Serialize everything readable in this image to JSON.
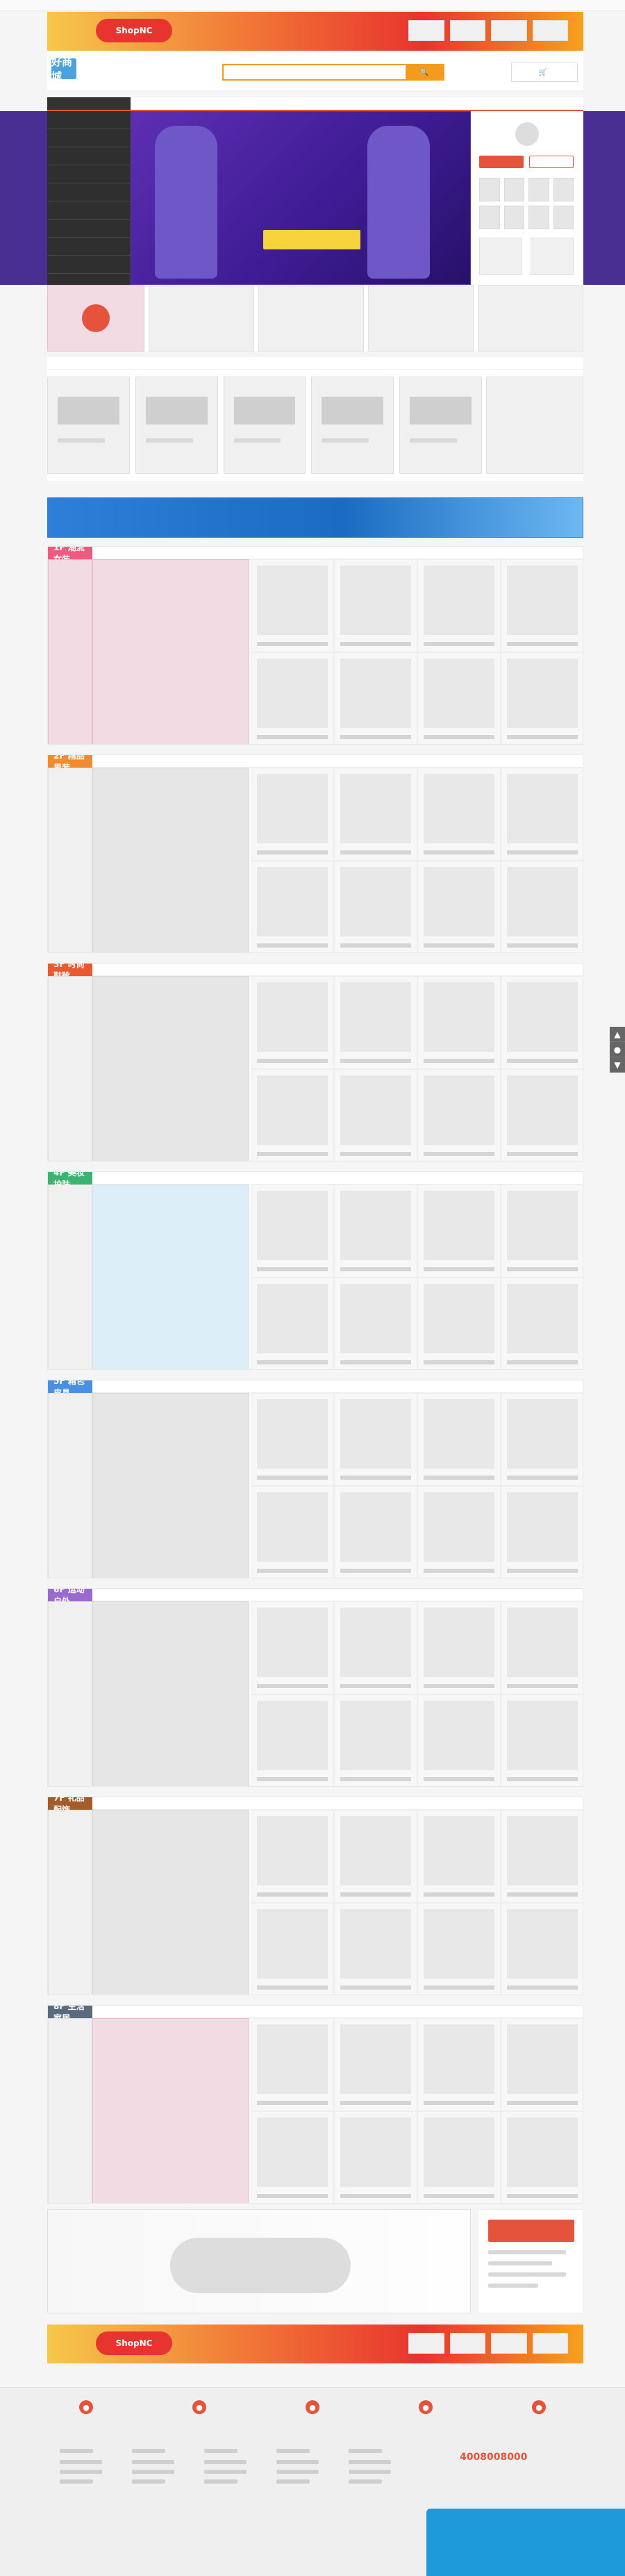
{
  "colors": {
    "accent": "#e5533d",
    "brand_green": "#2aa95b",
    "brand_blue": "#4aa3df",
    "top_banner_red": "#e8342e",
    "nav_red": "#e5533d",
    "floor_1": "#f05a7e",
    "floor_2": "#f28b2f",
    "floor_3": "#e95a31",
    "floor_4": "#3cb371",
    "floor_5": "#4a90e2",
    "floor_6": "#9a6ad1",
    "floor_7": "#a25d2a",
    "floor_8": "#5b6b7f"
  },
  "top_links": [
    "",
    "",
    "",
    "",
    "",
    "",
    ""
  ],
  "top_banner": {
    "left_logo": "ShopNC",
    "message": "",
    "tags": [
      "",
      "",
      "",
      ""
    ]
  },
  "header": {
    "logo": "好商城",
    "search_placeholder": "",
    "cart_label": ""
  },
  "nav": {
    "items": [
      "",
      "",
      "",
      "",
      "",
      "",
      "",
      "",
      "",
      ""
    ]
  },
  "sidebar": {
    "title": "",
    "items": [
      "",
      "",
      "",
      "",
      "",
      "",
      "",
      "",
      "",
      "",
      "",
      "",
      "",
      ""
    ]
  },
  "hero": {
    "headline": "",
    "subline": "",
    "cta": ""
  },
  "right_panel": {
    "login_button": "",
    "register_button": ""
  },
  "small_panels": [
    "",
    "",
    "",
    ""
  ],
  "recommend": {
    "title": "",
    "items": [
      "",
      "",
      "",
      "",
      "",
      ""
    ]
  },
  "promo_strip": {
    "text": ""
  },
  "floors": [
    {
      "name": "1F 潮流女装",
      "tabs": [
        "",
        "",
        "",
        "",
        "",
        ""
      ],
      "left_text": ""
    },
    {
      "name": "2F 精品男装",
      "tabs": [
        "",
        "",
        "",
        "",
        "",
        ""
      ],
      "left_text": ""
    },
    {
      "name": "3F 时尚鞋靴",
      "tabs": [
        "",
        "",
        "",
        "",
        "",
        ""
      ],
      "left_text": ""
    },
    {
      "name": "4F 美妆护肤",
      "tabs": [
        "",
        "",
        "",
        "",
        "",
        ""
      ],
      "left_text": ""
    },
    {
      "name": "5F 箱包皮具",
      "tabs": [
        "",
        "",
        "",
        "",
        "",
        ""
      ],
      "left_text": ""
    },
    {
      "name": "6F 运动户外",
      "tabs": [
        "",
        "",
        "",
        "",
        "",
        ""
      ],
      "left_text": ""
    },
    {
      "name": "7F 礼品配饰",
      "tabs": [
        "",
        "",
        "",
        "",
        "",
        ""
      ],
      "left_text": ""
    },
    {
      "name": "8F 生活家居",
      "tabs": [
        "",
        "",
        "",
        "",
        "",
        ""
      ],
      "left_text": ""
    }
  ],
  "bottom_left": {
    "title": ""
  },
  "bottom_right": {
    "title": "",
    "button": ""
  },
  "bottom_banner": {
    "left_logo": "ShopNC",
    "message": "",
    "tags": [
      "",
      "",
      "",
      ""
    ]
  },
  "footer": {
    "links": [
      "",
      "",
      "",
      "",
      ""
    ],
    "service_icons": [
      "",
      "",
      "",
      "",
      ""
    ],
    "columns": [
      {
        "title": ""
      },
      {
        "title": ""
      },
      {
        "title": ""
      },
      {
        "title": ""
      },
      {
        "title": ""
      }
    ],
    "phone": "4008008000",
    "email": "",
    "copyright": ""
  }
}
